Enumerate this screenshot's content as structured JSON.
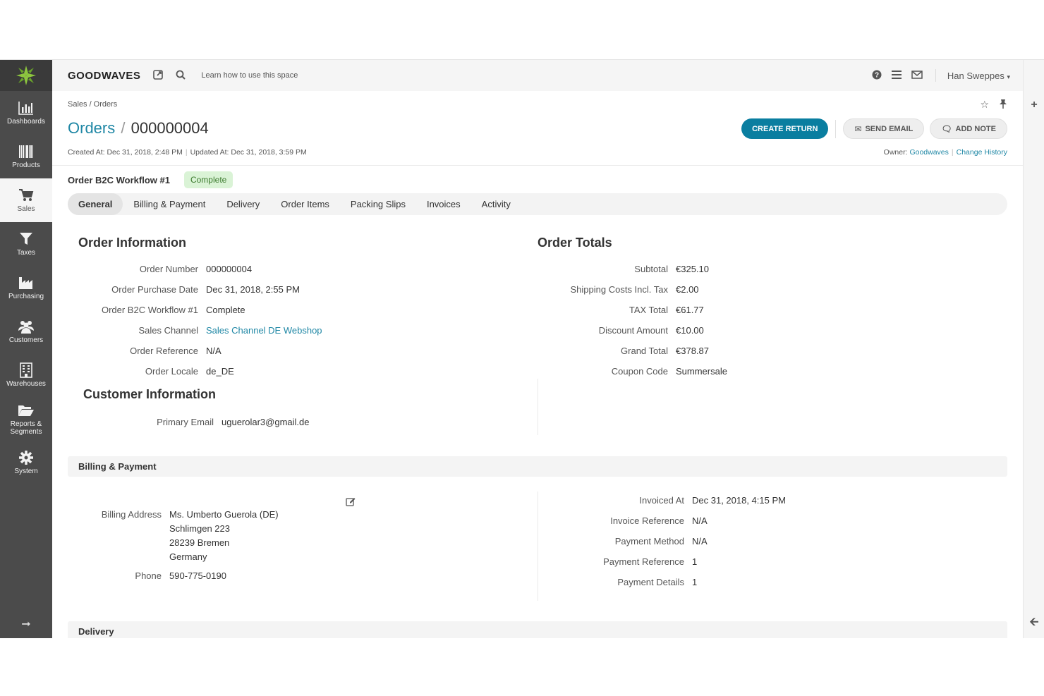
{
  "app": {
    "brand": "GOODWAVES",
    "search_hint": "Learn how to use this space",
    "user": "Han Sweppes"
  },
  "sidebar": {
    "items": [
      {
        "label": "Dashboards"
      },
      {
        "label": "Products"
      },
      {
        "label": "Sales"
      },
      {
        "label": "Taxes"
      },
      {
        "label": "Purchasing"
      },
      {
        "label": "Customers"
      },
      {
        "label": "Warehouses"
      },
      {
        "label": "Reports & Segments"
      },
      {
        "label": "System"
      }
    ]
  },
  "page": {
    "breadcrumb": "Sales / Orders",
    "title_section": "Orders",
    "title_separator": "/",
    "title_id": "000000004",
    "created": "Created At: Dec 31, 2018, 2:48 PM",
    "updated": "Updated At: Dec 31, 2018, 3:59 PM",
    "owner_label": "Owner:",
    "owner": "Goodwaves",
    "change_history": "Change History",
    "buttons": {
      "create_return": "CREATE RETURN",
      "send_email": "SEND EMAIL",
      "add_note": "ADD NOTE"
    },
    "workflow_label": "Order B2C Workflow #1",
    "status": "Complete"
  },
  "tabs": [
    "General",
    "Billing & Payment",
    "Delivery",
    "Order Items",
    "Packing Slips",
    "Invoices",
    "Activity"
  ],
  "order_information": {
    "title": "Order Information",
    "fields": [
      {
        "label": "Order Number",
        "value": "000000004"
      },
      {
        "label": "Order Purchase Date",
        "value": "Dec 31, 2018, 2:55 PM"
      },
      {
        "label": "Order B2C Workflow #1",
        "value": "Complete"
      },
      {
        "label": "Sales Channel",
        "value": "Sales Channel DE Webshop"
      },
      {
        "label": "Order Reference",
        "value": "N/A"
      },
      {
        "label": "Order Locale",
        "value": "de_DE"
      }
    ]
  },
  "order_totals": {
    "title": "Order Totals",
    "fields": [
      {
        "label": "Subtotal",
        "value": "€325.10"
      },
      {
        "label": "Shipping Costs Incl. Tax",
        "value": "€2.00"
      },
      {
        "label": "TAX Total",
        "value": "€61.77"
      },
      {
        "label": "Discount Amount",
        "value": "€10.00"
      },
      {
        "label": "Grand Total",
        "value": "€378.87"
      },
      {
        "label": "Coupon Code",
        "value": "Summersale"
      }
    ]
  },
  "customer_information": {
    "title": "Customer Information",
    "email_label": "Primary Email",
    "email": "uguerolar3@gmail.de"
  },
  "billing": {
    "title": "Billing & Payment",
    "address_label": "Billing Address",
    "address": [
      "Ms. Umberto Guerola (DE)",
      "Schlimgen 223",
      "28239 Bremen",
      "Germany"
    ],
    "phone_label": "Phone",
    "phone": "590-775-0190",
    "fields": [
      {
        "label": "Invoiced At",
        "value": "Dec 31, 2018, 4:15 PM"
      },
      {
        "label": "Invoice Reference",
        "value": "N/A"
      },
      {
        "label": "Payment Method",
        "value": "N/A"
      },
      {
        "label": "Payment Reference",
        "value": "1"
      },
      {
        "label": "Payment Details",
        "value": "1"
      }
    ]
  },
  "delivery": {
    "title": "Delivery"
  },
  "colors": {
    "sidebar": "#4b4b4b",
    "accent": "#0a7ea0",
    "link": "#1f87a5",
    "status_bg": "#daf3d6",
    "logo_green": "#8dc63f"
  }
}
